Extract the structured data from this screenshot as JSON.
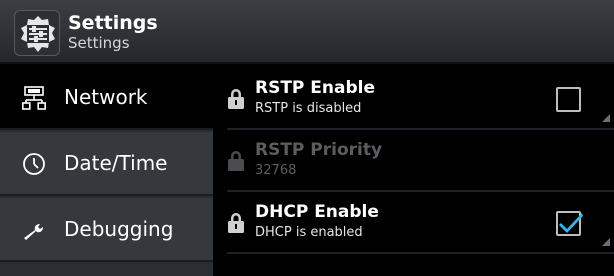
{
  "header": {
    "title": "Settings",
    "subtitle": "Settings",
    "icon": "settings-app-icon"
  },
  "sidebar": {
    "items": [
      {
        "label": "Network",
        "icon": "network-icon",
        "selected": true
      },
      {
        "label": "Date/Time",
        "icon": "clock-icon",
        "selected": false
      },
      {
        "label": "Debugging",
        "icon": "wrench-icon",
        "selected": false
      }
    ]
  },
  "preferences": [
    {
      "title": "RSTP Enable",
      "summary": "RSTP is disabled",
      "enabled": true,
      "checked": false,
      "icon": "lock-icon"
    },
    {
      "title": "RSTP Priority",
      "summary": "32768",
      "enabled": false,
      "icon": "lock-icon"
    },
    {
      "title": "DHCP Enable",
      "summary": "DHCP is enabled",
      "enabled": true,
      "checked": true,
      "icon": "lock-icon"
    }
  ],
  "colors": {
    "accent": "#33b5e5",
    "header_bg": "#2f3237",
    "sidebar_bg": "#35383c",
    "selected_bg": "#000000",
    "disabled_text": "#5b5d60"
  }
}
